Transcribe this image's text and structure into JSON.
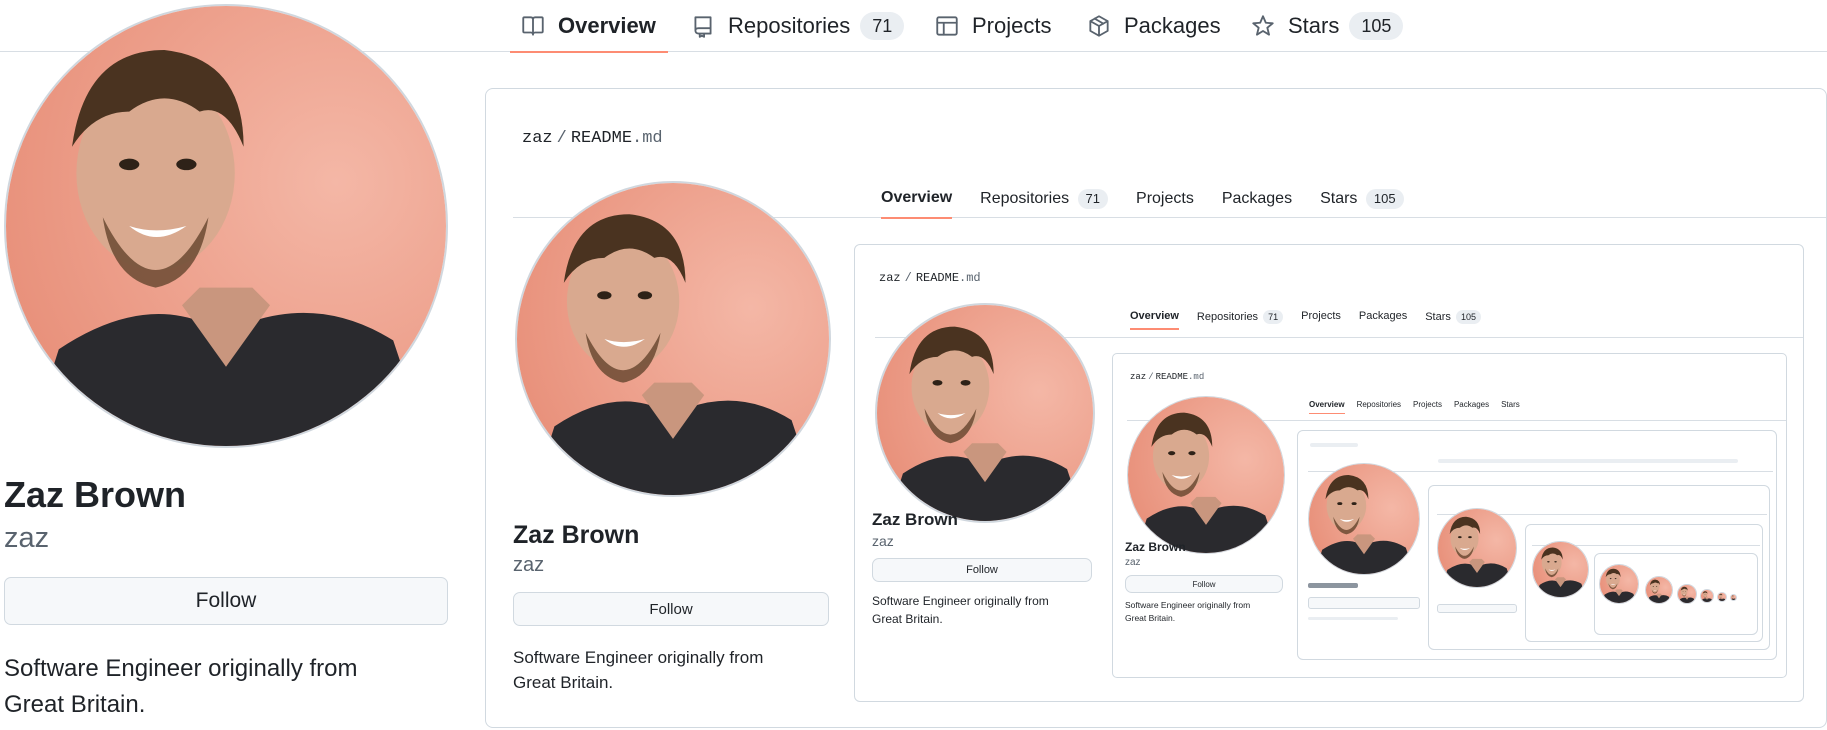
{
  "nav": {
    "tabs": [
      {
        "label": "Overview",
        "icon": "book-icon",
        "active": true
      },
      {
        "label": "Repositories",
        "icon": "repo-icon",
        "count": "71"
      },
      {
        "label": "Projects",
        "icon": "table-icon"
      },
      {
        "label": "Packages",
        "icon": "package-icon"
      },
      {
        "label": "Stars",
        "icon": "star-icon",
        "count": "105"
      }
    ],
    "accent_color": "#fd8c73"
  },
  "profile": {
    "name": "Zaz Brown",
    "login": "zaz",
    "follow_label": "Follow",
    "bio_line1": "Software Engineer originally from",
    "bio_line2": "Great Britain.",
    "avatar_background": "#f0a08c"
  },
  "readme": {
    "owner": "zaz",
    "separator": "/",
    "file": "README",
    "ext": ".md"
  },
  "colors": {
    "border": "#d1d9e0",
    "muted": "#59636e",
    "counter_bg": "#eaeef2",
    "button_bg": "#f6f8fa"
  }
}
